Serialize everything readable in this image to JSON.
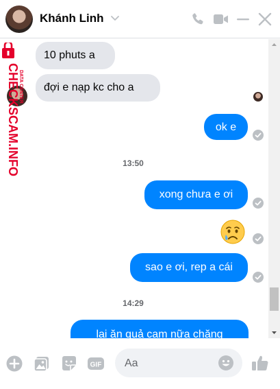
{
  "header": {
    "contact_name": "Khánh Linh"
  },
  "watermark": {
    "brand": "CHECKSCAM.INFO",
    "subtitle": "DATA CENTER"
  },
  "messages": [
    {
      "side": "incoming",
      "text": "10 phuts a"
    },
    {
      "side": "incoming",
      "text": "đợi e nạp kc cho a"
    },
    {
      "side": "outgoing",
      "text": "ok e"
    },
    {
      "side": "outgoing",
      "text": "xong chưa e ơi"
    },
    {
      "side": "outgoing",
      "text": "😢"
    },
    {
      "side": "outgoing",
      "text": "sao e ơi, rep a cái"
    },
    {
      "side": "outgoing",
      "text": "lại ăn quả cam nữa chăng"
    }
  ],
  "timestamps": [
    "13:50",
    "14:29"
  ],
  "composer": {
    "placeholder": "Aa"
  },
  "colors": {
    "outgoing_bubble": "#0084ff",
    "incoming_bubble": "#e4e6eb",
    "accent_icons": "#bcc0c4",
    "timestamp": "#65676b",
    "watermark": "#e4002b"
  },
  "icons": {
    "header": [
      "chevron-down-icon",
      "phone-icon",
      "video-camera-icon",
      "minimize-icon",
      "close-icon"
    ],
    "footer": [
      "plus-circle-icon",
      "image-icon",
      "sticker-icon",
      "gif-icon",
      "emoji-icon",
      "thumbs-up-icon"
    ]
  }
}
